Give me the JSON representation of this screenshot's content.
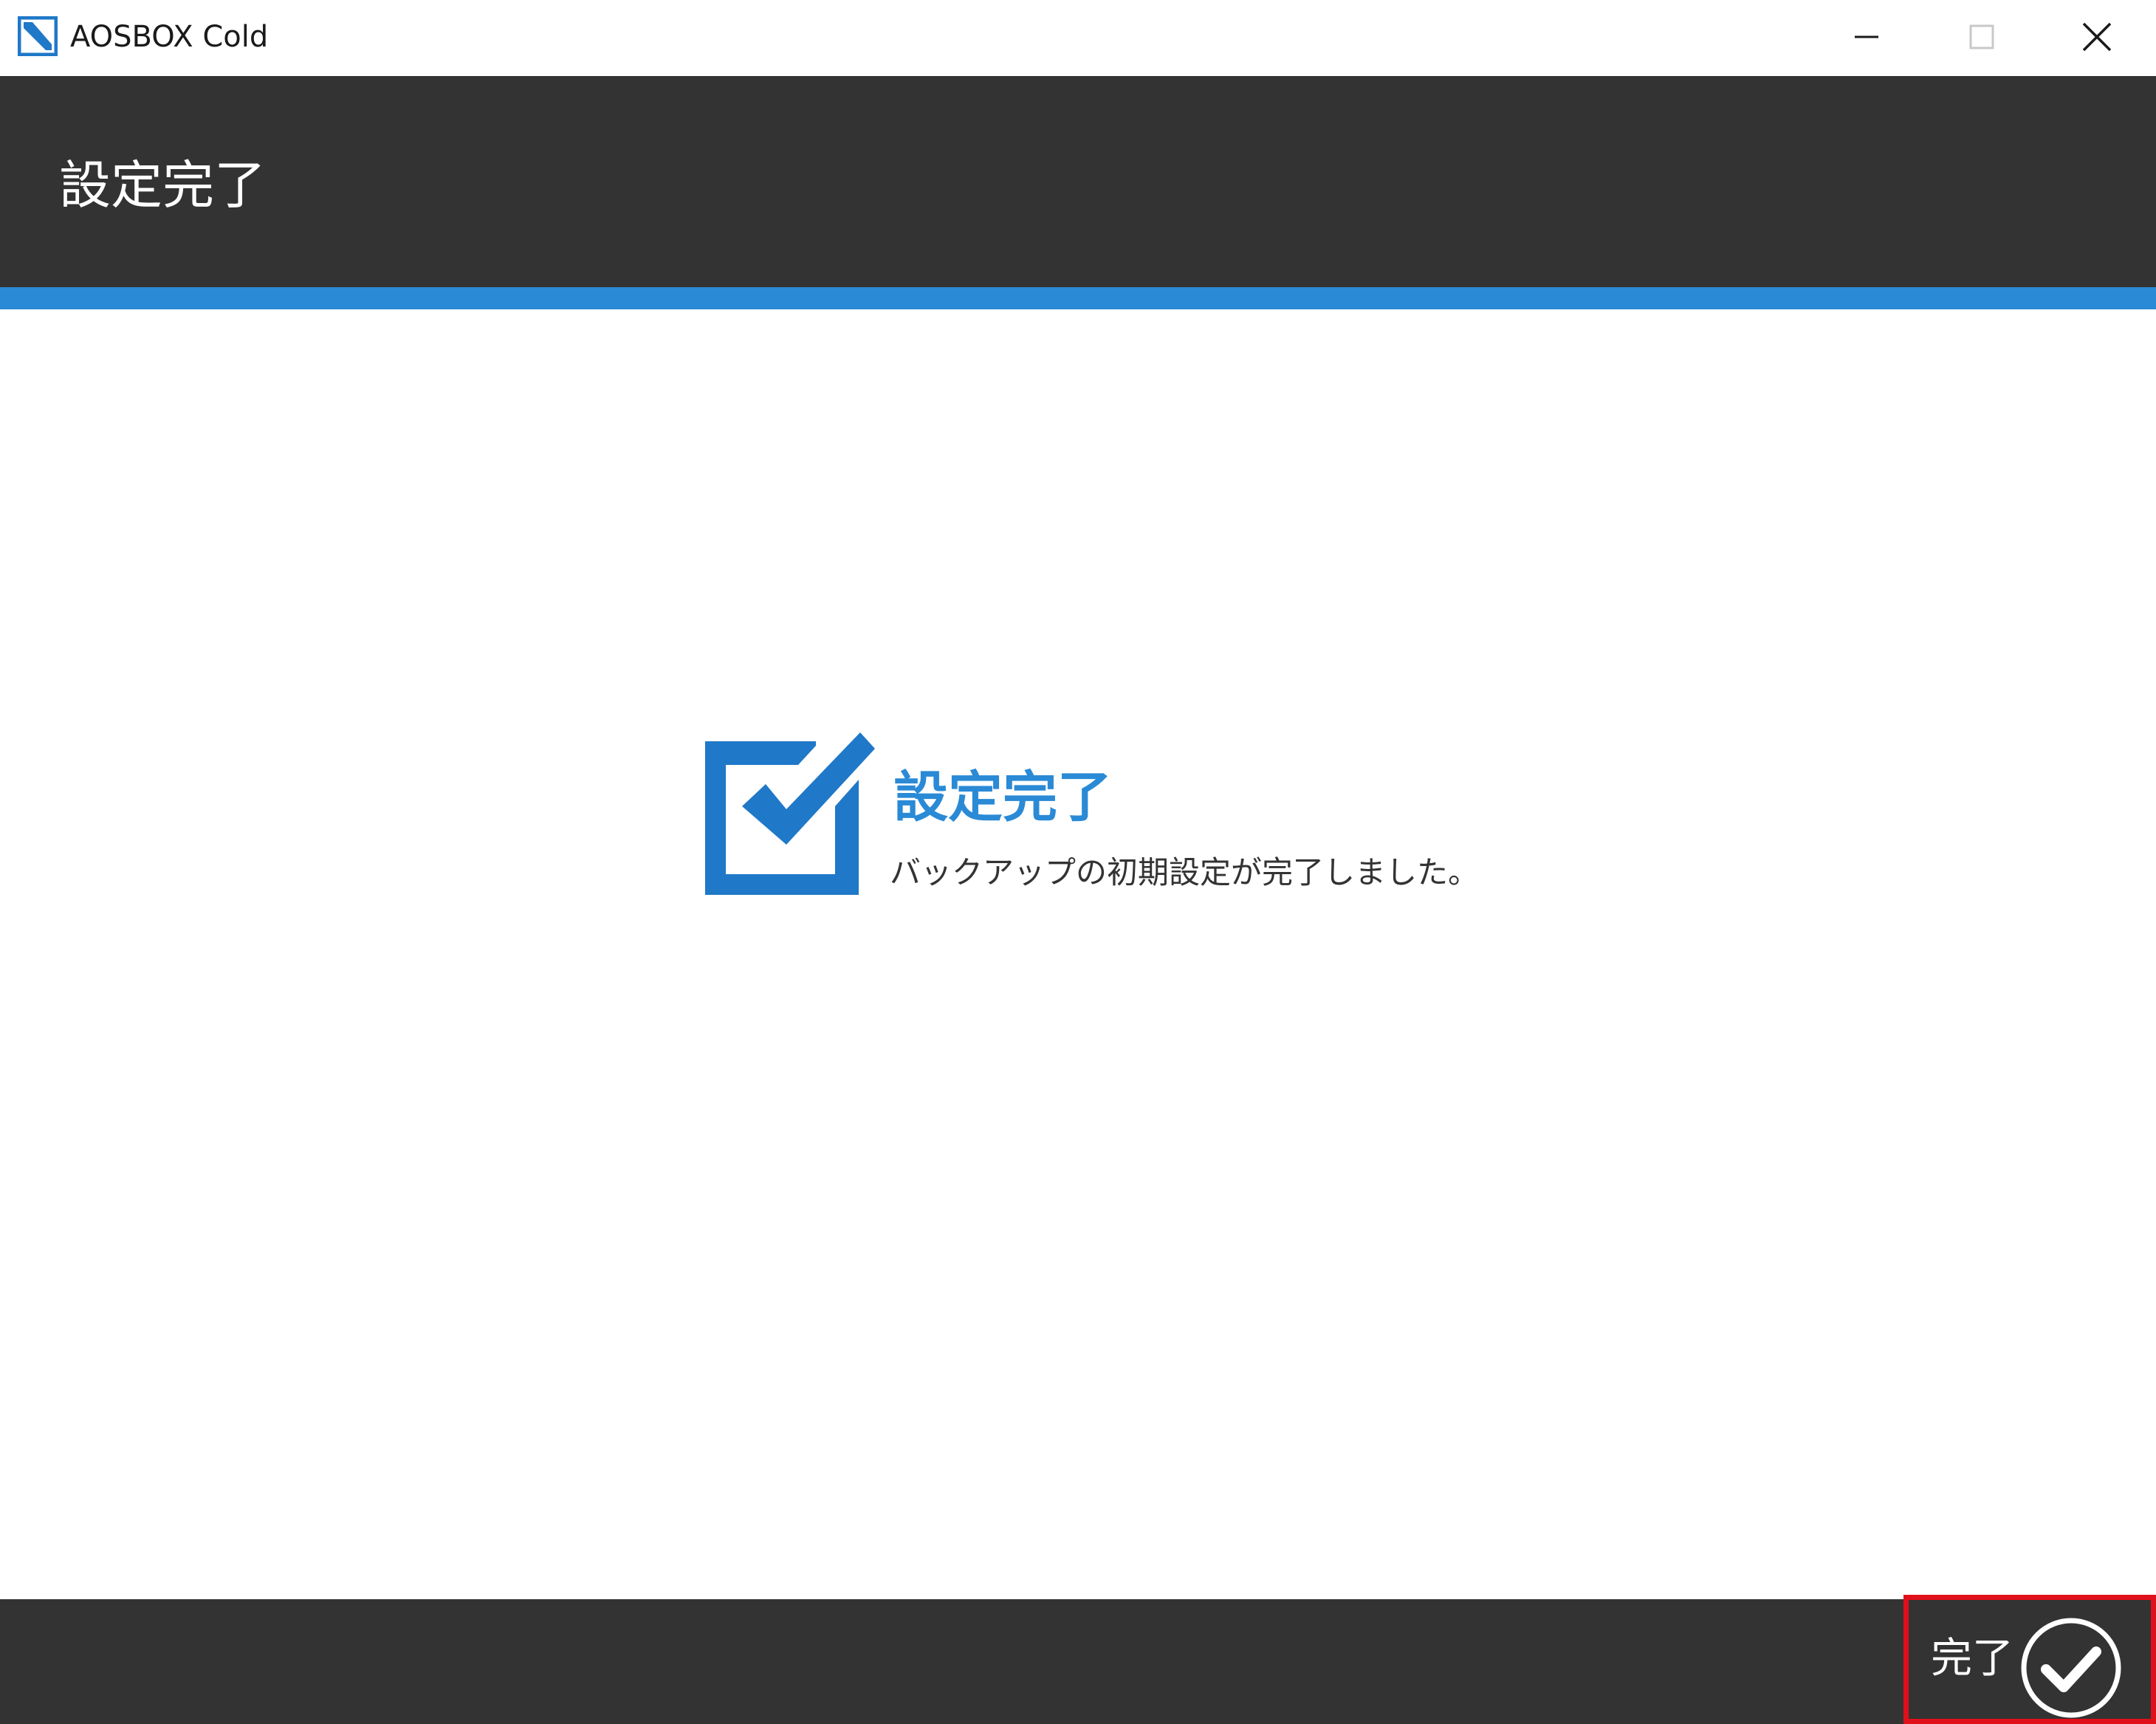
{
  "window": {
    "title": "AOSBOX Cold",
    "icon": "aosbox-app-icon",
    "controls": {
      "minimize_icon": "minimize-icon",
      "maximize_icon": "maximize-icon",
      "close_icon": "close-icon"
    }
  },
  "header": {
    "title": "設定完了"
  },
  "main": {
    "status_icon": "checkbox-checked-icon",
    "heading": "設定完了",
    "message": "バックアップの初期設定が完了しました。"
  },
  "footer": {
    "finish_label": "完了",
    "finish_icon": "circle-check-icon"
  },
  "colors": {
    "accent": "#2a8ad6",
    "header_bg": "#333333",
    "highlight": "#e0101a"
  }
}
